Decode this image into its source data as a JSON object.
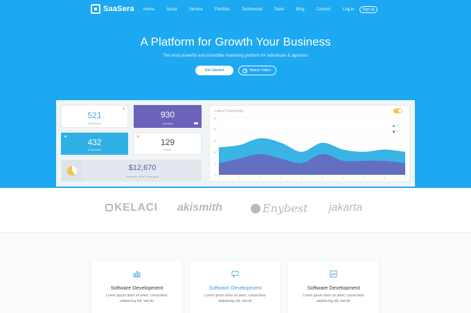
{
  "nav": {
    "brand": "SaaSera",
    "links": [
      "Home",
      "About",
      "Service",
      "Portfolio",
      "Testimonial",
      "Team",
      "Blog",
      "Contact"
    ],
    "login": "Log in",
    "signup": "Sign up"
  },
  "hero": {
    "title": "A Platform for Growth Your Business",
    "subtitle": "The most powerful and incredible marketing platform for individuals & agencies",
    "primary_button": "Get Started",
    "secondary_button": "Watch Video"
  },
  "dashboard": {
    "stats": [
      {
        "value": "521",
        "label": "New Items"
      },
      {
        "value": "930",
        "label": "Uploads"
      },
      {
        "value": "432",
        "label": "Comments"
      },
      {
        "value": "129",
        "label": "Feeds"
      }
    ],
    "revenue": {
      "value": "$12,670",
      "label": "Revenue, 60% of the goal",
      "fraction": 0.6
    },
    "chart_title": "Latest Campaign",
    "legend": [
      "PV",
      "UV"
    ]
  },
  "chart_data": {
    "type": "area",
    "title": "Latest Campaign",
    "x": [
      0,
      1,
      2,
      3,
      4,
      5,
      6,
      7,
      8,
      9
    ],
    "ylim": [
      0,
      25
    ],
    "yticks": [
      0,
      5,
      10,
      15,
      20,
      25
    ],
    "series": [
      {
        "name": "PV",
        "values": [
          12,
          13,
          16,
          14,
          10,
          14,
          11,
          10,
          11,
          10
        ]
      },
      {
        "name": "UV",
        "values": [
          5,
          7,
          9,
          7,
          5,
          9,
          6,
          6,
          6,
          5
        ]
      }
    ],
    "grid": true
  },
  "logos": [
    "KELACI",
    "akismith",
    "Enybest",
    "jakarta"
  ],
  "services": [
    {
      "title": "Software Development",
      "desc": "Lorem ipsum dolor sit amet, consectetur adipisicing elit, sed do",
      "icon": "bar-chart-icon"
    },
    {
      "title": "Software Development",
      "desc": "Lorem ipsum dolor sit amet, consectetur adipisicing elit, sed do",
      "icon": "chat-icon"
    },
    {
      "title": "Software Development",
      "desc": "Lorem ipsum dolor sit amet, consectetur adipisicing elit, sed do",
      "icon": "image-chart-icon"
    }
  ],
  "colors": {
    "hero": "#1da8f2",
    "purple": "#6b63ba",
    "cyan": "#2eb0e4",
    "accent": "#f2c53d"
  }
}
